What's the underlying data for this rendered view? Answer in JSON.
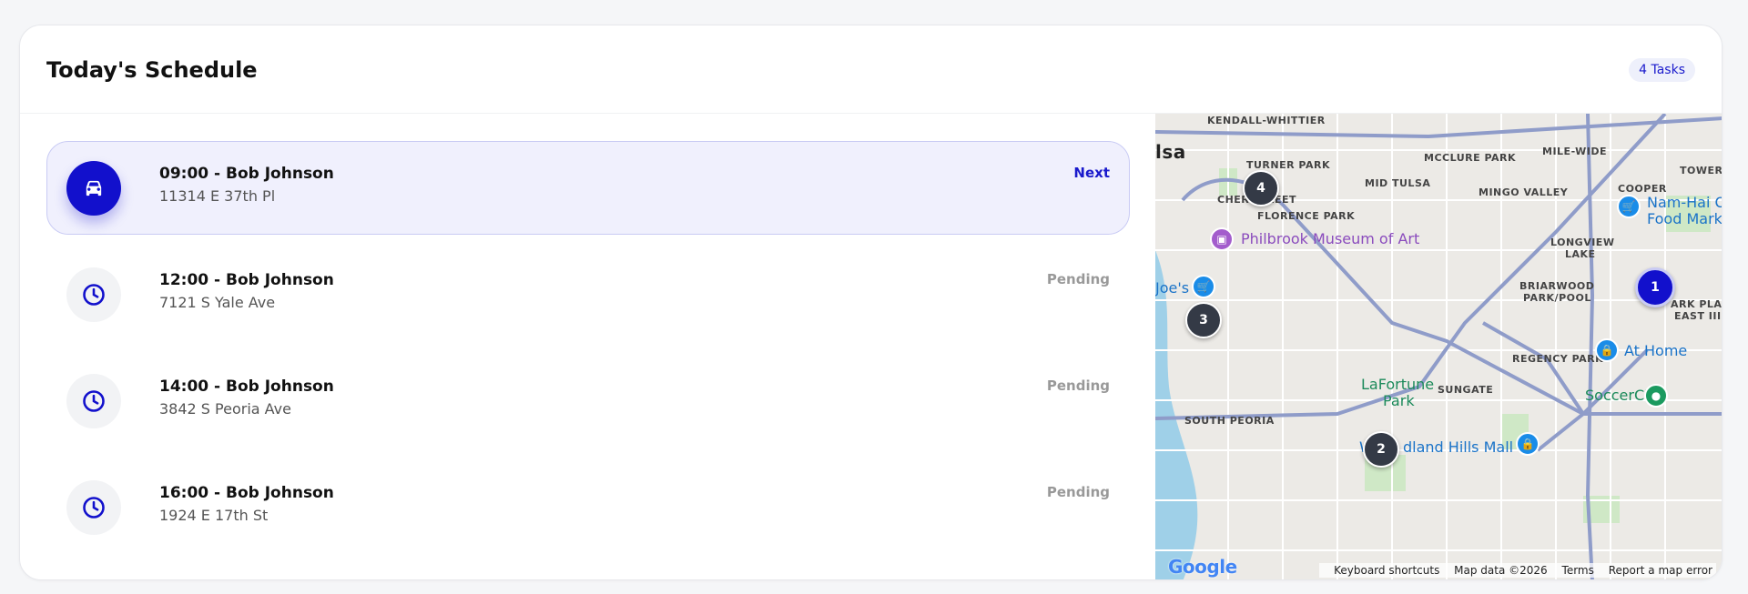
{
  "header": {
    "title": "Today's Schedule",
    "task_count": "4 Tasks"
  },
  "tasks": [
    {
      "title": "09:00 - Bob Johnson",
      "address": "11314 E 37th Pl",
      "status": "Next",
      "icon": "car-icon"
    },
    {
      "title": "12:00 - Bob Johnson",
      "address": "7121 S Yale Ave",
      "status": "Pending",
      "icon": "clock-icon"
    },
    {
      "title": "14:00 - Bob Johnson",
      "address": "3842 S Peoria Ave",
      "status": "Pending",
      "icon": "clock-icon"
    },
    {
      "title": "16:00 - Bob Johnson",
      "address": "1924 E 17th St",
      "status": "Pending",
      "icon": "clock-icon"
    }
  ],
  "map": {
    "labels": {
      "kendall": "KENDALL-WHITTIER",
      "tulsa": "lsa",
      "turner": "TURNER PARK",
      "mcclure": "MCCLURE PARK",
      "milewide": "MILE-WIDE",
      "midtulsa": "MID TULSA",
      "mingo": "MINGO VALLEY",
      "cooper": "COOPER",
      "tower": "TOWER H",
      "cherry": "CHER",
      "street": "REET",
      "florence": "FLORENCE PARK",
      "longview": "LONGVIEW",
      "lake": "LAKE",
      "briarwood": "BRIARWOOD",
      "parkpool": "PARK/POOL",
      "parkplaza": "ARK PLAZ",
      "eastiii": "EAST III &",
      "regency": "REGENCY PARK",
      "sungate": "SUNGATE",
      "southpeoria": "SOUTH PEORIA"
    },
    "pois": {
      "philbrook": "Philbrook Museum of Art",
      "joes": "Joe's",
      "namhai": "Nam-Hai O",
      "foodmark": "Food Mark",
      "athome": "At Home",
      "soccercity": "SoccerCity",
      "lafortune": "LaFortune",
      "park": "Park",
      "woodland": "W",
      "woodland2": "dland Hills Mall"
    },
    "markers": [
      "1",
      "2",
      "3",
      "4"
    ],
    "footer": {
      "logo": "Google",
      "shortcuts": "Keyboard shortcuts",
      "mapdata": "Map data ©2026",
      "terms": "Terms",
      "report": "Report a map error"
    },
    "colors": {
      "primary_marker": "#1210cc",
      "secondary_marker": "#343a46",
      "water": "#9fd0e8",
      "park": "#cfe8c6",
      "highway": "#8f9cc9"
    }
  }
}
